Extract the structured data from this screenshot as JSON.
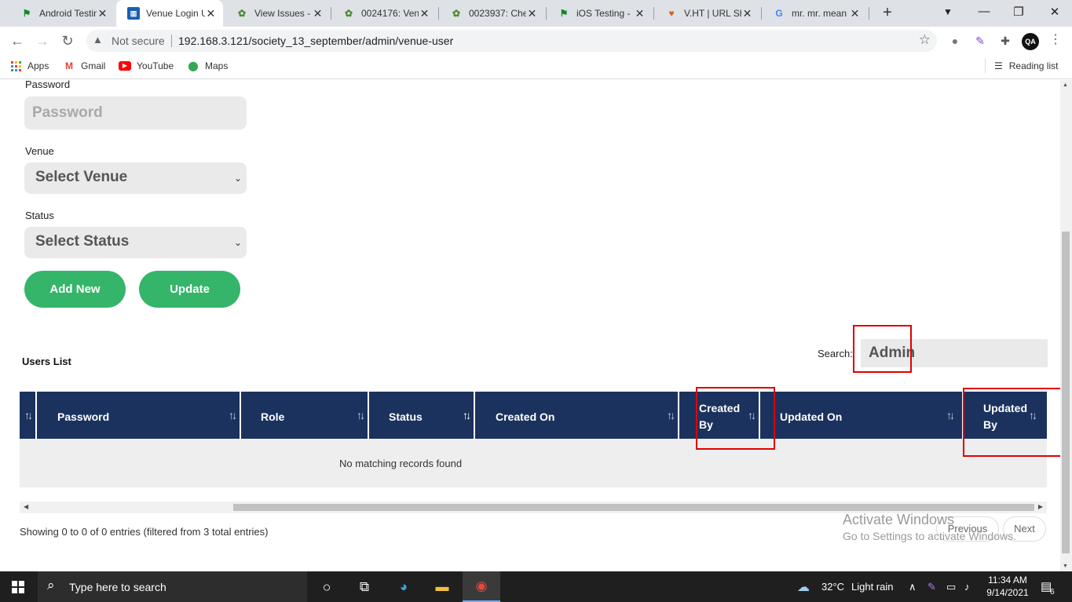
{
  "browser": {
    "tabs": [
      {
        "title": "Android Testin",
        "icon": "green-flag-icon"
      },
      {
        "title": "Venue Login U",
        "icon": "venue-app-icon",
        "active": true
      },
      {
        "title": "View Issues -",
        "icon": "bug-icon"
      },
      {
        "title": "0024176: Ven",
        "icon": "bug-icon"
      },
      {
        "title": "0023937: Che",
        "icon": "bug-icon"
      },
      {
        "title": "iOS Testing -",
        "icon": "green-flag-icon"
      },
      {
        "title": "V.HT | URL Sh",
        "icon": "vht-icon"
      },
      {
        "title": "mr. mr. mean",
        "icon": "google-icon"
      }
    ],
    "not_secure": "Not secure",
    "url": "192.168.3.121/society_13_september/admin/venue-user",
    "bookmarks": [
      "Apps",
      "Gmail",
      "YouTube",
      "Maps"
    ],
    "reading_list": "Reading list",
    "profile_initials": "QA"
  },
  "form": {
    "password_label": "Password",
    "password_placeholder": "Password",
    "venue_label": "Venue",
    "venue_value": "Select Venue",
    "status_label": "Status",
    "status_value": "Select Status",
    "add_new_label": "Add New",
    "update_label": "Update"
  },
  "users_list": {
    "title": "Users List",
    "search_label": "Search:",
    "search_value": "Admin",
    "columns": [
      "Password",
      "Role",
      "Status",
      "Created On",
      "Created By",
      "Updated On",
      "Updated By"
    ],
    "empty_message": "No matching records found",
    "info": "Showing 0 to 0 of 0 entries (filtered from 3 total entries)",
    "previous_label": "Previous",
    "next_label": "Next"
  },
  "watermark": {
    "line1": "Activate Windows",
    "line2": "Go to Settings to activate Windows."
  },
  "taskbar": {
    "search_placeholder": "Type here to search",
    "weather_temp": "32°C",
    "weather_text": "Light rain",
    "time": "11:34 AM",
    "date": "9/14/2021",
    "notification_count": "6"
  },
  "colors": {
    "accent_green": "#35b56a",
    "table_header": "#1c325e",
    "highlight_red": "#e00000"
  }
}
